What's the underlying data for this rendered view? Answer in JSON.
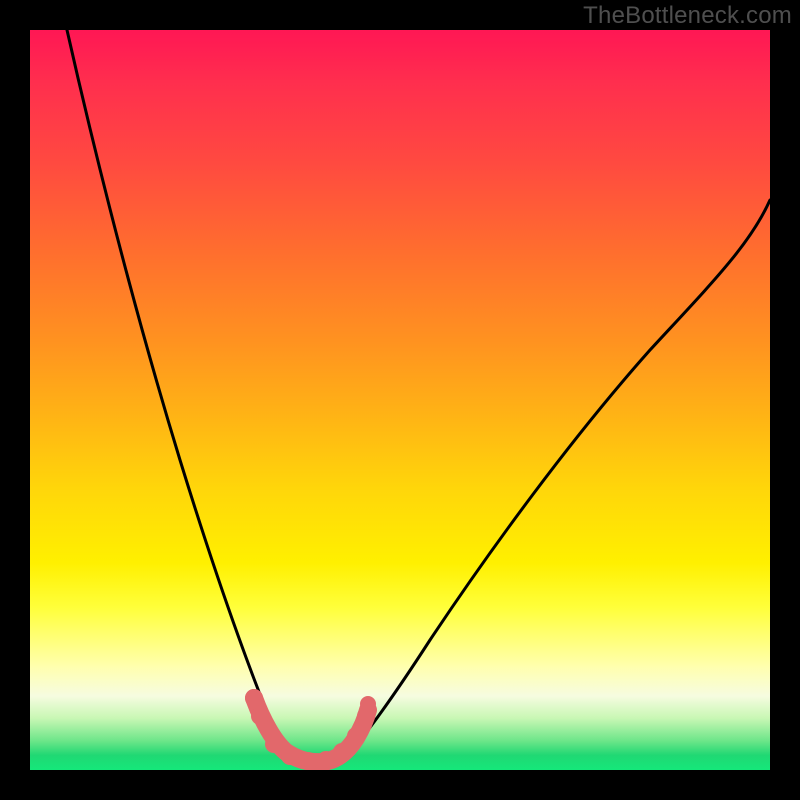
{
  "watermark": "TheBottleneck.com",
  "chart_data": {
    "type": "line",
    "title": "",
    "xlabel": "",
    "ylabel": "",
    "xlim": [
      0,
      100
    ],
    "ylim": [
      0,
      100
    ],
    "grid": false,
    "legend": false,
    "series": [
      {
        "name": "curve-left",
        "color": "#000000",
        "x": [
          5,
          7,
          9,
          12,
          15,
          18,
          21,
          24,
          26,
          28,
          30,
          31.5,
          33,
          34.5,
          36
        ],
        "y": [
          100,
          90,
          80,
          68,
          57,
          47,
          38,
          29,
          22,
          16,
          11,
          7.5,
          5,
          3,
          2
        ]
      },
      {
        "name": "curve-right",
        "color": "#000000",
        "x": [
          42,
          44,
          47,
          50,
          54,
          58,
          63,
          68,
          74,
          80,
          86,
          92,
          98,
          100
        ],
        "y": [
          2,
          4,
          8,
          13,
          20,
          27,
          35,
          43,
          51,
          58,
          65,
          71,
          76,
          78
        ]
      },
      {
        "name": "valley-stroke",
        "color": "#e2686b",
        "x": [
          30,
          31.5,
          33,
          34.5,
          36,
          38,
          40,
          42,
          43.5,
          45
        ],
        "y": [
          9,
          5.5,
          3.5,
          2.5,
          2,
          2,
          2,
          2.5,
          4,
          7
        ]
      }
    ],
    "gradient_stops": [
      {
        "pos": 0.0,
        "color": "#ff1754"
      },
      {
        "pos": 0.18,
        "color": "#ff4a40"
      },
      {
        "pos": 0.42,
        "color": "#ff9220"
      },
      {
        "pos": 0.62,
        "color": "#ffd60a"
      },
      {
        "pos": 0.78,
        "color": "#ffff3a"
      },
      {
        "pos": 0.9,
        "color": "#f6fce0"
      },
      {
        "pos": 0.96,
        "color": "#6fe68a"
      },
      {
        "pos": 1.0,
        "color": "#15e77a"
      }
    ]
  }
}
